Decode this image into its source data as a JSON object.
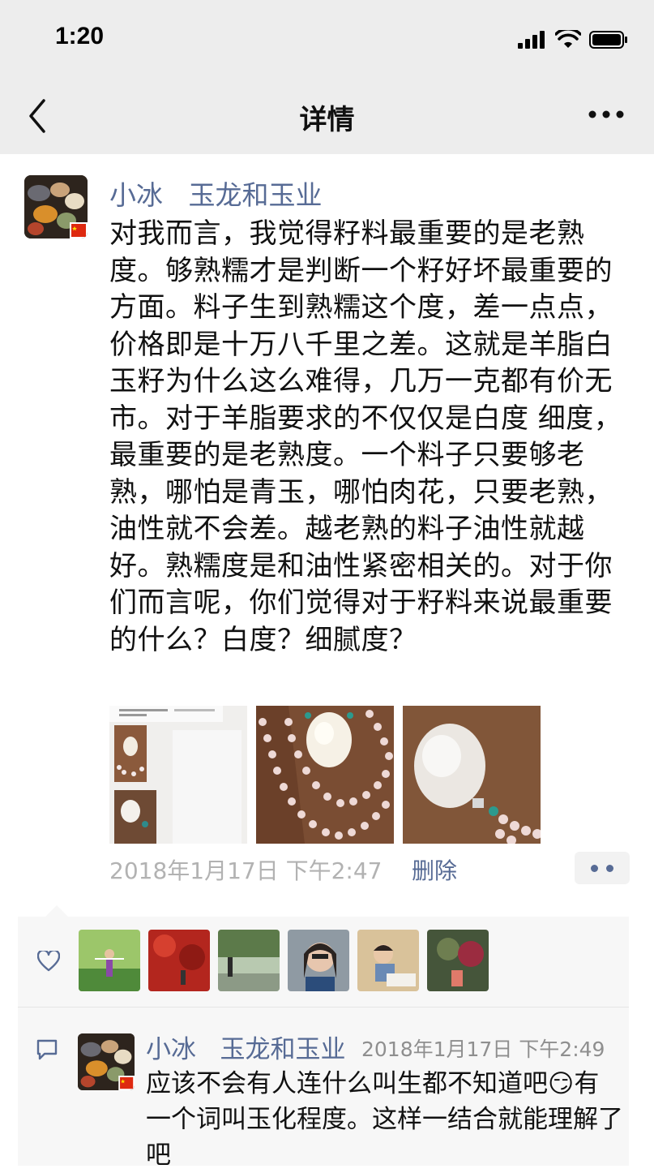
{
  "status_bar": {
    "time": "1:20"
  },
  "nav": {
    "title": "详情",
    "back_icon": "chevron-left-icon",
    "more_icon": "more-dots-icon"
  },
  "post": {
    "author": "小冰   玉龙和玉业",
    "text": "对我而言，我觉得籽料最重要的是老熟度。够熟糯才是判断一个籽好坏最重要的方面。料子生到熟糯这个度，差一点点，价格即是十万八千里之差。这就是羊脂白玉籽为什么这么难得，几万一克都有价无市。对于羊脂要求的不仅仅是白度 细度，最重要的是老熟度。一个料子只要够老熟，哪怕是青玉，哪怕肉花，只要老熟，油性就不会差。越老熟的料子油性就越好。熟糯度是和油性紧密相关的。对于你们而言呢，你们觉得对于籽料来说最重要的什么？白度？细腻度？",
    "timestamp": "2018年1月17日 下午2:47",
    "delete_label": "删除",
    "photos": [
      "screenshot-photo",
      "jade-necklace-photo",
      "jade-pendant-photo"
    ]
  },
  "likes": {
    "icon": "heart-icon",
    "count": 6
  },
  "comment": {
    "icon": "comment-icon",
    "author": "小冰   玉龙和玉业",
    "time": "2018年1月17日 下午2:49",
    "text": "应该不会有人连什么叫生都不知道吧😏有一个词叫玉化程度。这样一结合就能理解了吧"
  },
  "colors": {
    "link": "#576b95",
    "nav_bg": "#ededed",
    "muted": "#b2b2b2",
    "panel": "#f7f7f7"
  }
}
